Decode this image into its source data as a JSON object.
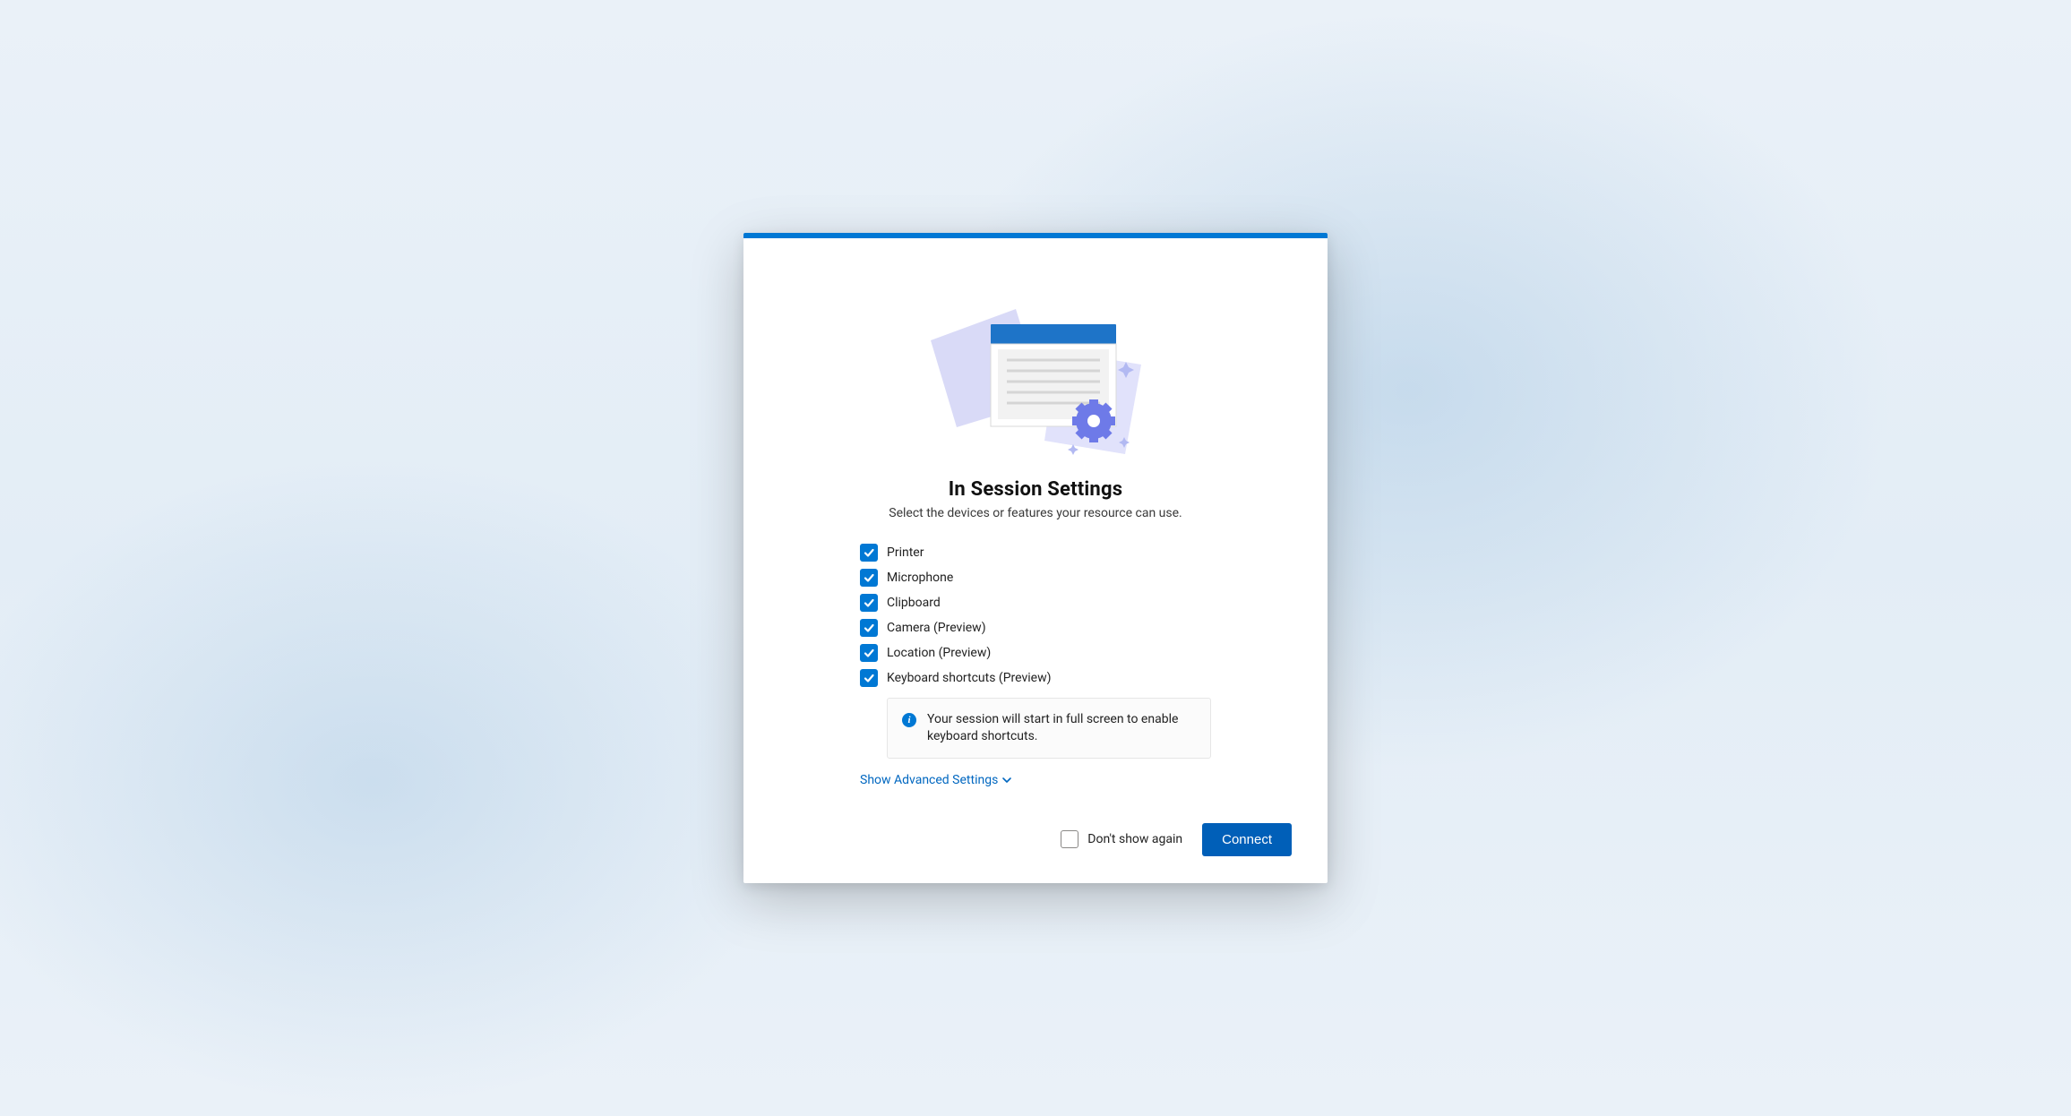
{
  "title": "In Session Settings",
  "subtitle": "Select the devices or features your resource can use.",
  "options": [
    {
      "label": "Printer",
      "checked": true
    },
    {
      "label": "Microphone",
      "checked": true
    },
    {
      "label": "Clipboard",
      "checked": true
    },
    {
      "label": "Camera (Preview)",
      "checked": true
    },
    {
      "label": "Location (Preview)",
      "checked": true
    },
    {
      "label": "Keyboard shortcuts (Preview)",
      "checked": true
    }
  ],
  "info_callout": "Your session will start in full screen to enable keyboard shortcuts.",
  "advanced_label": "Show Advanced Settings",
  "footer": {
    "dont_show_label": "Don't show again",
    "dont_show_checked": false,
    "connect_label": "Connect"
  },
  "accent_color": "#0078d4"
}
